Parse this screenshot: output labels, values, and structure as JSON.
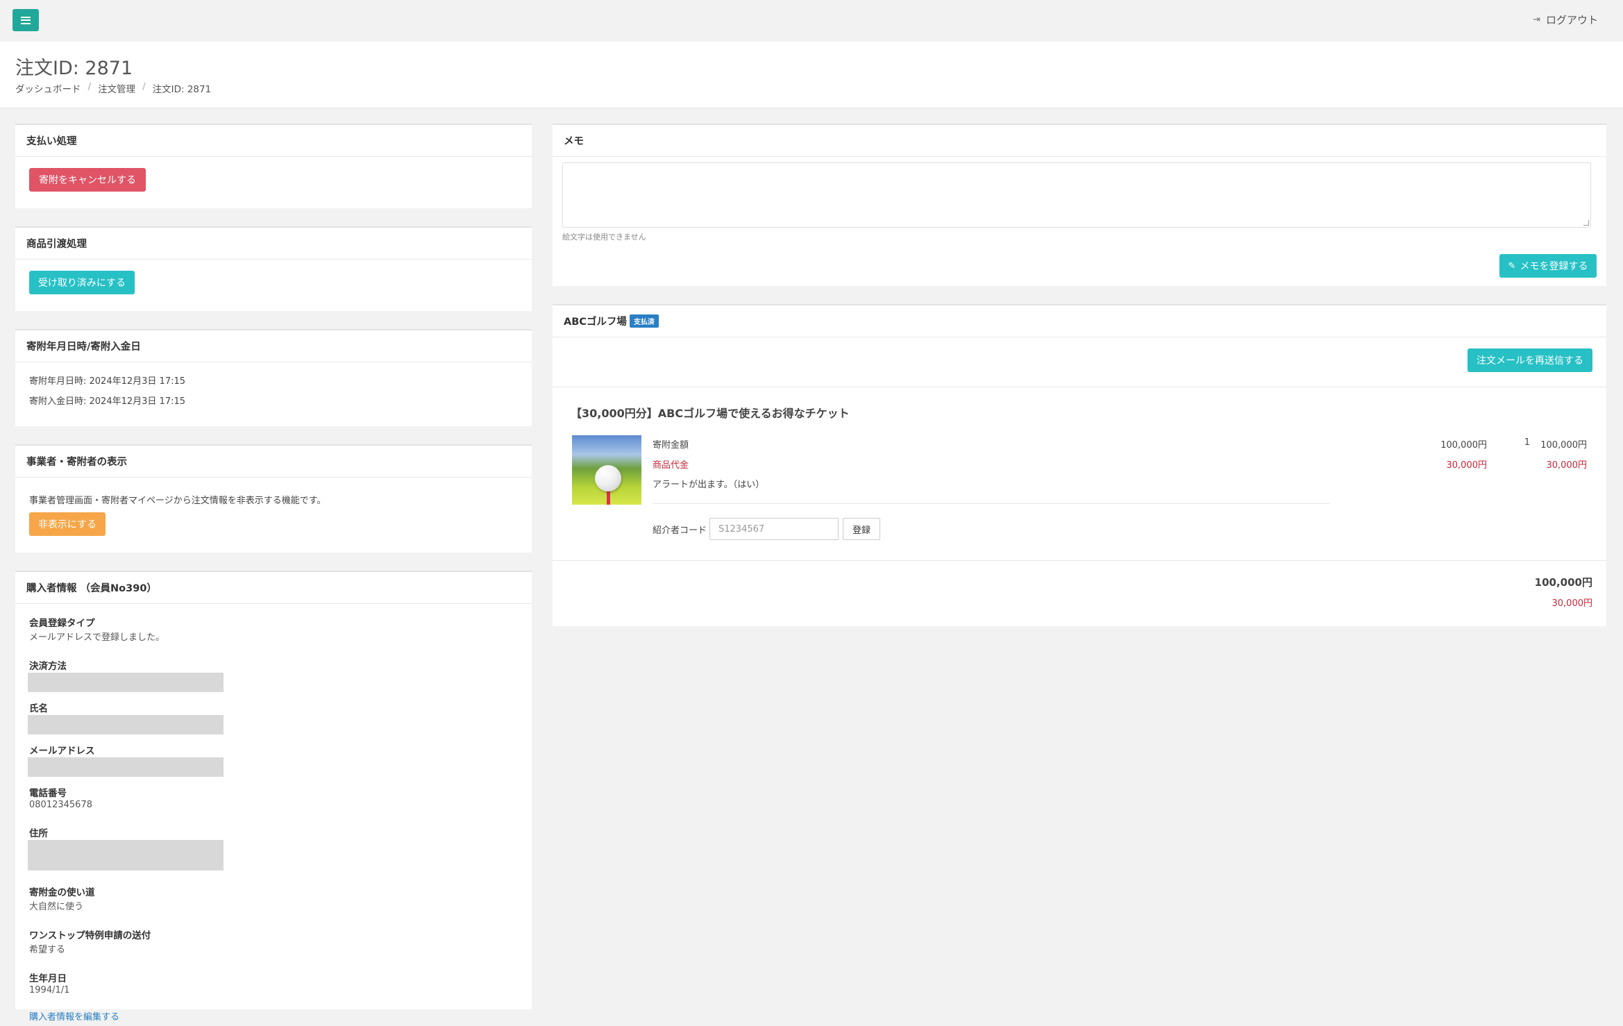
{
  "header": {
    "menu_icon": "hamburger-menu-icon",
    "logout_label": "ログアウト"
  },
  "page": {
    "title": "注文ID: 2871",
    "breadcrumb": [
      "ダッシュボード",
      "注文管理",
      "注文ID: 2871"
    ]
  },
  "payment": {
    "title": "支払い処理",
    "cancel_label": "寄附をキャンセルする"
  },
  "delivery": {
    "title": "商品引渡処理",
    "received_label": "受け取り済みにする"
  },
  "dates": {
    "title": "寄附年月日時/寄附入金日",
    "donation_datetime": "寄附年月日時: 2024年12月3日 17:15",
    "payment_datetime": "寄附入金日時: 2024年12月3日 17:15"
  },
  "visibility": {
    "title": "事業者・寄附者の表示",
    "description": "事業者管理画面・寄附者マイページから注文情報を非表示する機能です。",
    "hide_label": "非表示にする"
  },
  "buyer": {
    "title": "購入者情報 （会員No390）",
    "reg_type_label": "会員登録タイプ",
    "reg_type_value": "メールアドレスで登録しました。",
    "payment_method_label": "決済方法",
    "name_label": "氏名",
    "email_label": "メールアドレス",
    "phone_label": "電話番号",
    "phone_value": "08012345678",
    "address_label": "住所",
    "usage_label": "寄附金の使い道",
    "usage_value": "大自然に使う",
    "onestop_label": "ワンストップ特例申請の送付",
    "onestop_value": "希望する",
    "birthday_label": "生年月日",
    "birthday_value": "1994/1/1",
    "edit_link": "購入者情報を編集する"
  },
  "memo": {
    "title": "メモ",
    "value": "",
    "hint": "絵文字は使用できません",
    "save_label": "メモを登録する"
  },
  "order": {
    "shop_name": "ABCゴルフ場",
    "status_badge": "支払済",
    "resend_label": "注文メールを再送信する",
    "product_title": "【30,000円分】ABCゴルフ場で使えるお得なチケット",
    "donation_label": "寄附金額",
    "donation_unit": "100,000円",
    "quantity": "1",
    "donation_total": "100,000円",
    "product_cost_label": "商品代金",
    "product_cost_unit": "30,000円",
    "product_cost_total": "30,000円",
    "alert_text": "アラートが出ます。（はい）",
    "referral_label": "紹介者コード",
    "referral_placeholder": "S1234567",
    "referral_button": "登録",
    "grand_total": "100,000円",
    "grand_cost": "30,000円"
  },
  "colors": {
    "teal": "#27c0c5",
    "menu_green": "#22a89a",
    "red": "#e05466",
    "orange": "#f6a648",
    "badge_blue": "#2a7fc4",
    "text_red": "#c8273a"
  }
}
